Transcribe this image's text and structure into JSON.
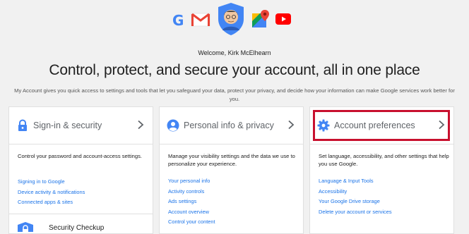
{
  "header": {
    "welcome": "Welcome, Kirk McElhearn",
    "headline": "Control, protect, and secure your account, all in one place",
    "intro": "My Account gives you quick access to settings and tools that let you safeguard your data, protect your privacy, and decide how your information can make Google services work better for you.",
    "app_icons": [
      "google-g-icon",
      "gmail-icon",
      "avatar",
      "maps-icon",
      "youtube-icon"
    ],
    "g_letter": "G"
  },
  "cards": [
    {
      "title": "Sign-in & security",
      "icon": "lock-icon",
      "description": "Control your password and account-access settings.",
      "links": [
        "Signing in to Google",
        "Device activity & notifications",
        "Connected apps & sites"
      ],
      "footer": "Security Checkup"
    },
    {
      "title": "Personal info & privacy",
      "icon": "person-icon",
      "description": "Manage your visibility settings and the data we use to personalize your experience.",
      "links": [
        "Your personal info",
        "Activity controls",
        "Ads settings",
        "Account overview",
        "Control your content"
      ]
    },
    {
      "title": "Account preferences",
      "icon": "gear-icon",
      "description": "Set language, accessibility, and other settings that help you use Google.",
      "links": [
        "Language & Input Tools",
        "Accessibility",
        "Your Google Drive storage",
        "Delete your account or services"
      ]
    }
  ],
  "colors": {
    "link": "#1a73e8",
    "icon_blue": "#4285f4",
    "highlight": "#c8102e"
  }
}
